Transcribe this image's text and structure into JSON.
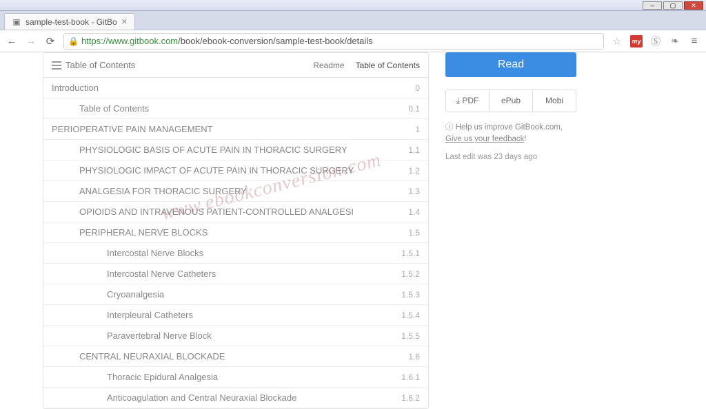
{
  "window": {
    "tab_title": "sample-test-book - GitBo"
  },
  "addr": {
    "proto": "https://",
    "host": "www.gitbook.com",
    "path": "/book/ebook-conversion/sample-test-book/details"
  },
  "ext": {
    "red": "my"
  },
  "panel": {
    "title": "Table of Contents",
    "tabs": {
      "readme": "Readme",
      "toc": "Table of Contents"
    }
  },
  "toc": [
    {
      "label": "Introduction",
      "num": "0",
      "level": 0
    },
    {
      "label": "Table of Contents",
      "num": "0.1",
      "level": 1
    },
    {
      "label": "PERIOPERATIVE PAIN MANAGEMENT",
      "num": "1",
      "level": 0
    },
    {
      "label": "PHYSIOLOGIC BASIS OF ACUTE PAIN IN THORACIC SURGERY",
      "num": "1.1",
      "level": 1
    },
    {
      "label": "PHYSIOLOGIC IMPACT OF ACUTE PAIN IN THORACIC SURGERY",
      "num": "1.2",
      "level": 1
    },
    {
      "label": "ANALGESIA FOR THORACIC SURGERY",
      "num": "1.3",
      "level": 1
    },
    {
      "label": "OPIOIDS AND INTRAVENOUS PATIENT-CONTROLLED ANALGESI",
      "num": "1.4",
      "level": 1
    },
    {
      "label": "PERIPHERAL NERVE BLOCKS",
      "num": "1.5",
      "level": 1
    },
    {
      "label": "Intercostal Nerve Blocks",
      "num": "1.5.1",
      "level": 2
    },
    {
      "label": "Intercostal Nerve Catheters",
      "num": "1.5.2",
      "level": 2
    },
    {
      "label": "Cryoanalgesia",
      "num": "1.5.3",
      "level": 2
    },
    {
      "label": "Interpleural Catheters",
      "num": "1.5.4",
      "level": 2
    },
    {
      "label": "Paravertebral Nerve Block",
      "num": "1.5.5",
      "level": 2
    },
    {
      "label": "CENTRAL NEURAXIAL BLOCKADE",
      "num": "1.6",
      "level": 1
    },
    {
      "label": "Thoracic Epidural Analgesia",
      "num": "1.6.1",
      "level": 2
    },
    {
      "label": "Anticoagulation and Central Neuraxial Blockade",
      "num": "1.6.2",
      "level": 2
    }
  ],
  "sidebar": {
    "read": "Read",
    "formats": {
      "pdf": "PDF",
      "epub": "ePub",
      "mobi": "Mobi"
    },
    "feedback_pre": "Help us improve GitBook.com, ",
    "feedback_link": "Give us your feedback",
    "feedback_post": "!",
    "last_edit": "Last edit was 23 days ago"
  },
  "watermark": "www.ebookconversion.com"
}
